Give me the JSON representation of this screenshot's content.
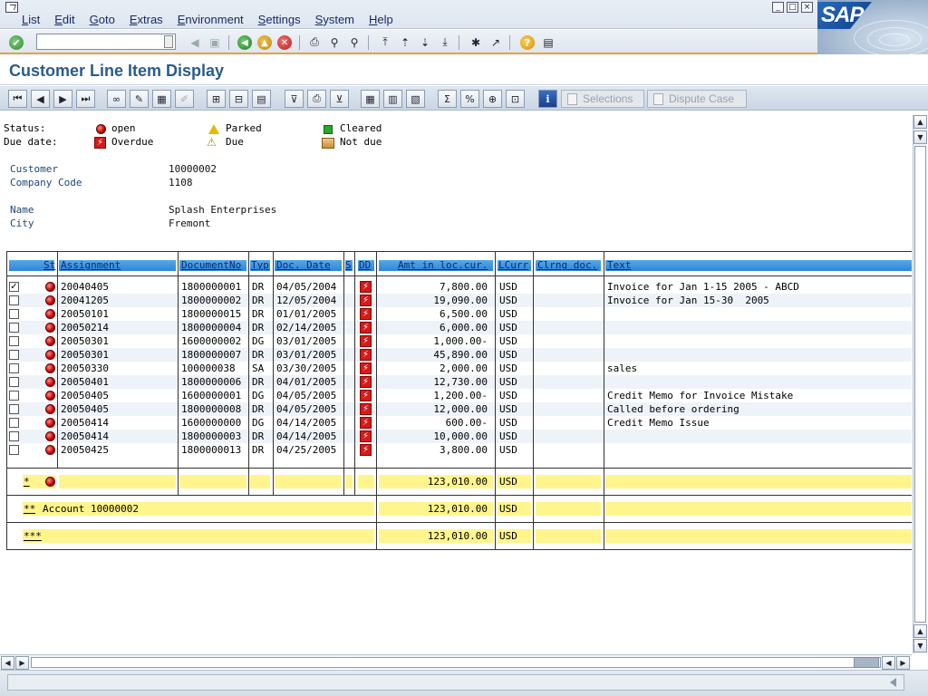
{
  "menu": [
    "List",
    "Edit",
    "Goto",
    "Extras",
    "Environment",
    "Settings",
    "System",
    "Help"
  ],
  "brand": {
    "logo_text": "SAP"
  },
  "command_field": {
    "value": ""
  },
  "title": "Customer Line Item Display",
  "app_toolbar": {
    "selections_label": "Selections",
    "dispute_label": "Dispute Case"
  },
  "legend": {
    "status_label": "Status:",
    "due_label": "Due date:",
    "open": "open",
    "parked": "Parked",
    "cleared": "Cleared",
    "overdue": "Overdue",
    "due": "Due",
    "not_due": "Not due"
  },
  "header": {
    "customer_label": "Customer",
    "customer_value": "10000002",
    "company_code_label": "Company Code",
    "company_code_value": "1108",
    "name_label": "Name",
    "name_value": "Splash Enterprises",
    "city_label": "City",
    "city_value": "Fremont"
  },
  "columns": {
    "st": "St",
    "assignment": "Assignment",
    "document_no": "DocumentNo",
    "typ": "Typ",
    "doc_date": "Doc. Date",
    "s": "S",
    "dd": "DD",
    "amount": "Amt in loc.cur.",
    "lcurr": "LCurr",
    "clrng_doc": "Clrng doc.",
    "text": "Text"
  },
  "rows": [
    {
      "checked": true,
      "assignment": "20040405",
      "doc": "1800000001",
      "typ": "DR",
      "date": "04/05/2004",
      "amount": "7,800.00",
      "curr": "USD",
      "text": "Invoice for Jan 1-15 2005 - ABCD"
    },
    {
      "checked": false,
      "assignment": "20041205",
      "doc": "1800000002",
      "typ": "DR",
      "date": "12/05/2004",
      "amount": "19,090.00",
      "curr": "USD",
      "text": "Invoice for Jan 15-30  2005"
    },
    {
      "checked": false,
      "assignment": "20050101",
      "doc": "1800000015",
      "typ": "DR",
      "date": "01/01/2005",
      "amount": "6,500.00",
      "curr": "USD",
      "text": ""
    },
    {
      "checked": false,
      "assignment": "20050214",
      "doc": "1800000004",
      "typ": "DR",
      "date": "02/14/2005",
      "amount": "6,000.00",
      "curr": "USD",
      "text": ""
    },
    {
      "checked": false,
      "assignment": "20050301",
      "doc": "1600000002",
      "typ": "DG",
      "date": "03/01/2005",
      "amount": "1,000.00-",
      "curr": "USD",
      "text": ""
    },
    {
      "checked": false,
      "assignment": "20050301",
      "doc": "1800000007",
      "typ": "DR",
      "date": "03/01/2005",
      "amount": "45,890.00",
      "curr": "USD",
      "text": ""
    },
    {
      "checked": false,
      "assignment": "20050330",
      "doc": "100000038",
      "typ": "SA",
      "date": "03/30/2005",
      "amount": "2,000.00",
      "curr": "USD",
      "text": "sales"
    },
    {
      "checked": false,
      "assignment": "20050401",
      "doc": "1800000006",
      "typ": "DR",
      "date": "04/01/2005",
      "amount": "12,730.00",
      "curr": "USD",
      "text": ""
    },
    {
      "checked": false,
      "assignment": "20050405",
      "doc": "1600000001",
      "typ": "DG",
      "date": "04/05/2005",
      "amount": "1,200.00-",
      "curr": "USD",
      "text": "Credit Memo for Invoice Mistake"
    },
    {
      "checked": false,
      "assignment": "20050405",
      "doc": "1800000008",
      "typ": "DR",
      "date": "04/05/2005",
      "amount": "12,000.00",
      "curr": "USD",
      "text": "Called before ordering"
    },
    {
      "checked": false,
      "assignment": "20050414",
      "doc": "1600000000",
      "typ": "DG",
      "date": "04/14/2005",
      "amount": "600.00-",
      "curr": "USD",
      "text": "Credit Memo Issue"
    },
    {
      "checked": false,
      "assignment": "20050414",
      "doc": "1800000003",
      "typ": "DR",
      "date": "04/14/2005",
      "amount": "10,000.00",
      "curr": "USD",
      "text": ""
    },
    {
      "checked": false,
      "assignment": "20050425",
      "doc": "1800000013",
      "typ": "DR",
      "date": "04/25/2005",
      "amount": "3,800.00",
      "curr": "USD",
      "text": ""
    }
  ],
  "totals": {
    "subtotal_marker": "*",
    "subtotal_amount": "123,010.00",
    "subtotal_curr": "USD",
    "account_marker": "**",
    "account_label": "Account 10000002",
    "account_amount": "123,010.00",
    "account_curr": "USD",
    "grand_marker": "***",
    "grand_amount": "123,010.00",
    "grand_curr": "USD"
  },
  "colors": {
    "title": "#2a5c8a",
    "header_bar": "#2e86d6",
    "total_yellow": "#fff58c",
    "accent_orange": "#e3a23d"
  }
}
